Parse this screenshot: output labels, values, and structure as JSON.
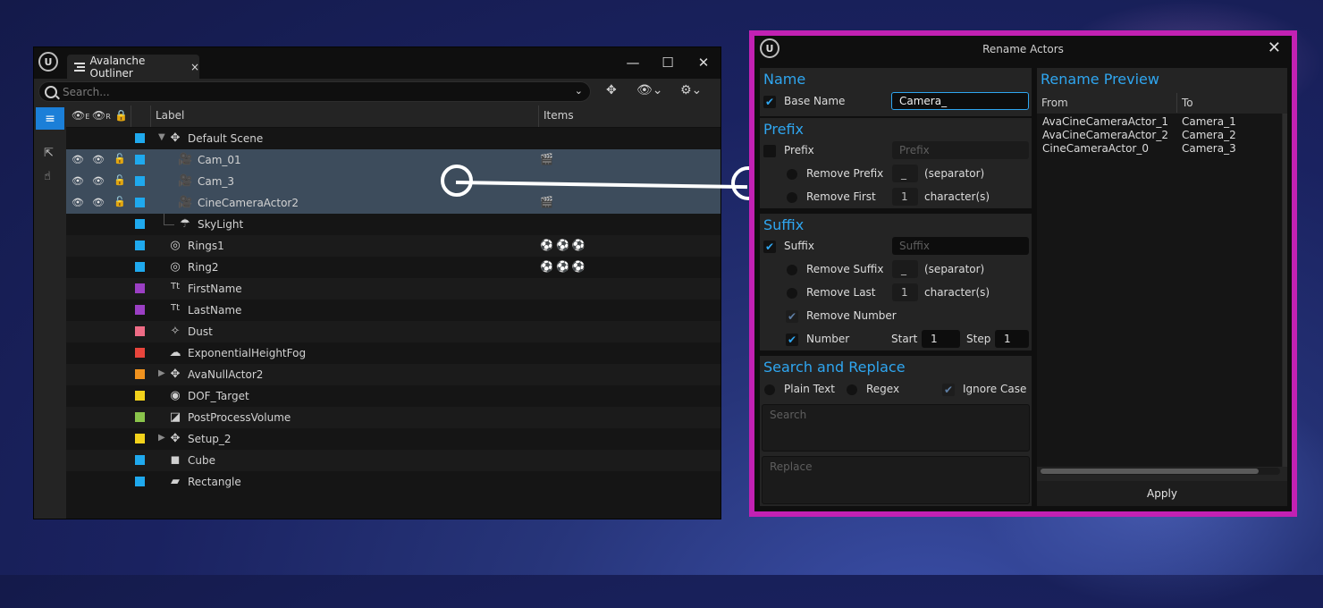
{
  "outliner": {
    "tab_title": "Avalanche Outliner",
    "tab_close": "×",
    "search_placeholder": "Search...",
    "window_buttons": {
      "minimize": "—",
      "maximize": "☐",
      "close": "✕"
    },
    "columns": {
      "label": "Label",
      "items": "Items",
      "col_e": "E",
      "col_r": "R"
    },
    "rows": [
      {
        "label": "Default Scene",
        "icon": "null-actor-icon",
        "color": "#1fa9ee",
        "items": ""
      },
      {
        "label": "Cam_01",
        "icon": "camera-icon",
        "color": "#1fa9ee",
        "items": "🎬"
      },
      {
        "label": "Cam_3",
        "icon": "camera-icon",
        "color": "#1fa9ee",
        "items": ""
      },
      {
        "label": "CineCameraActor2",
        "icon": "camera-icon",
        "color": "#1fa9ee",
        "items": "🎬"
      },
      {
        "label": "SkyLight",
        "icon": "skylight-icon",
        "color": "#1fa9ee",
        "items": ""
      },
      {
        "label": "Rings1",
        "icon": "ring-icon",
        "color": "#1fa9ee",
        "items": "⚽⚽⚽"
      },
      {
        "label": "Ring2",
        "icon": "ring-icon",
        "color": "#1fa9ee",
        "items": "⚽⚽⚽"
      },
      {
        "label": "FirstName",
        "icon": "text-icon",
        "color": "#9b3fc4",
        "items": ""
      },
      {
        "label": "LastName",
        "icon": "text-icon",
        "color": "#9b3fc4",
        "items": ""
      },
      {
        "label": "Dust",
        "icon": "particle-icon",
        "color": "#ee6c86",
        "items": ""
      },
      {
        "label": "ExponentialHeightFog",
        "icon": "fog-icon",
        "color": "#e8453c",
        "items": ""
      },
      {
        "label": "AvaNullActor2",
        "icon": "null-actor-icon",
        "color": "#f0921e",
        "items": ""
      },
      {
        "label": "DOF_Target",
        "icon": "target-icon",
        "color": "#f2d21b",
        "items": ""
      },
      {
        "label": "PostProcessVolume",
        "icon": "postprocess-icon",
        "color": "#8ac44b",
        "items": ""
      },
      {
        "label": "Setup_2",
        "icon": "null-actor-icon",
        "color": "#f2d21b",
        "items": ""
      },
      {
        "label": "Cube",
        "icon": "cube-icon",
        "color": "#1fa9ee",
        "items": ""
      },
      {
        "label": "Rectangle",
        "icon": "rectangle-icon",
        "color": "#1fa9ee",
        "items": ""
      }
    ]
  },
  "rename": {
    "title": "Rename Actors",
    "name_section": {
      "title": "Name",
      "base_name_label": "Base Name",
      "base_name_value": "Camera_"
    },
    "prefix_section": {
      "title": "Prefix",
      "prefix_label": "Prefix",
      "prefix_placeholder": "Prefix",
      "remove_prefix_label": "Remove Prefix",
      "remove_prefix_value": "_",
      "separator_label": "(separator)",
      "remove_first_label": "Remove First",
      "remove_first_value": "1",
      "characters_label": "character(s)"
    },
    "suffix_section": {
      "title": "Suffix",
      "suffix_label": "Suffix",
      "suffix_placeholder": "Suffix",
      "remove_suffix_label": "Remove Suffix",
      "remove_suffix_value": "_",
      "separator_label": "(separator)",
      "remove_last_label": "Remove Last",
      "remove_last_value": "1",
      "characters_label": "character(s)",
      "remove_number_label": "Remove Number",
      "number_label": "Number",
      "start_label": "Start",
      "start_value": "1",
      "step_label": "Step",
      "step_value": "1"
    },
    "search_section": {
      "title": "Search and Replace",
      "plain_text_label": "Plain Text",
      "regex_label": "Regex",
      "ignore_case_label": "Ignore Case",
      "search_placeholder": "Search",
      "replace_placeholder": "Replace"
    },
    "preview": {
      "title": "Rename Preview",
      "from_label": "From",
      "to_label": "To",
      "items": [
        {
          "from": "AvaCineCameraActor_1",
          "to": "Camera_1"
        },
        {
          "from": "AvaCineCameraActor_2",
          "to": "Camera_2"
        },
        {
          "from": "CineCameraActor_0",
          "to": "Camera_3"
        }
      ],
      "apply_label": "Apply"
    }
  },
  "colors": {
    "accent": "#2fa6f0",
    "frame": "#c221b3",
    "selection": "#3d4c5c"
  }
}
